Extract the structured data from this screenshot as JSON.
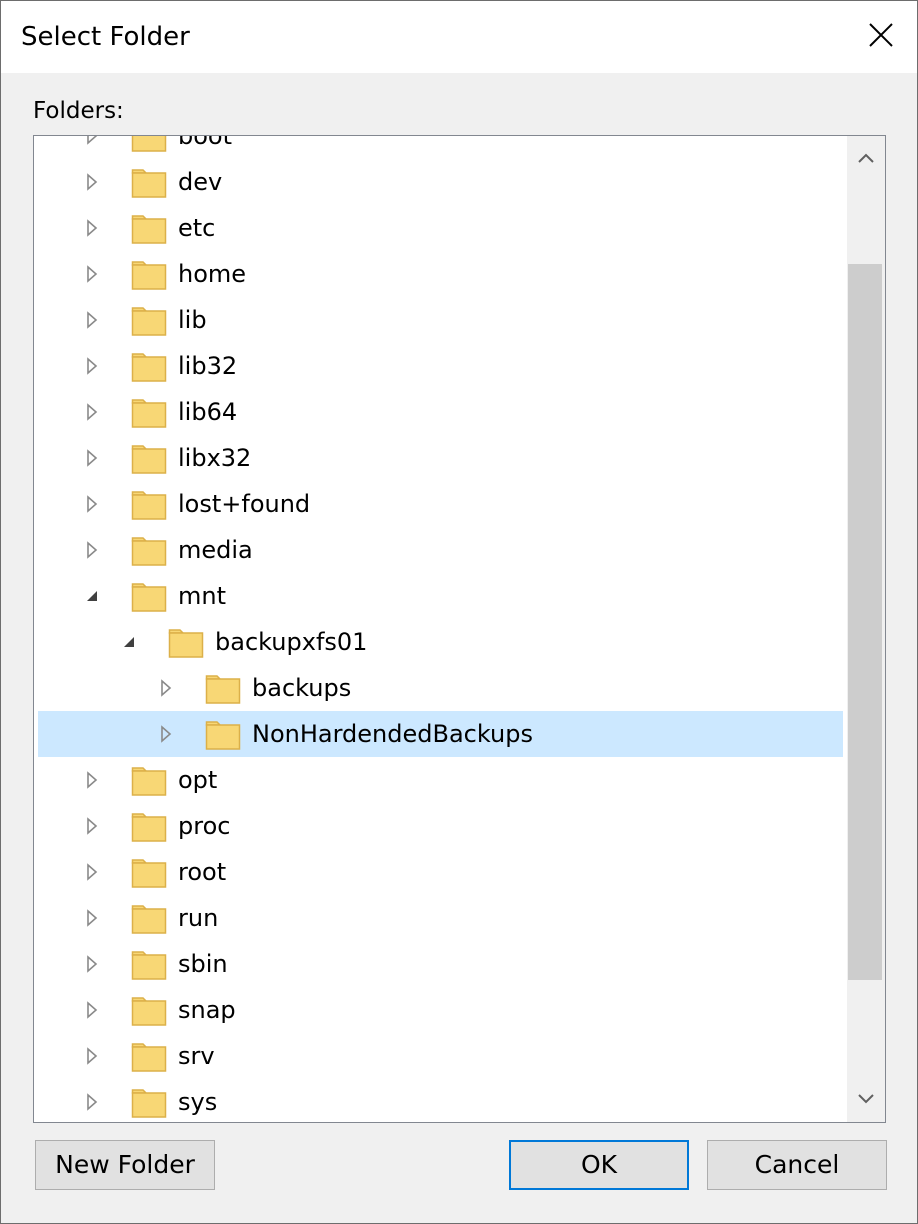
{
  "window": {
    "title": "Select Folder",
    "close_icon": "close-icon"
  },
  "folders_label": "Folders:",
  "tree": {
    "items": [
      {
        "label": "boot",
        "depth": 0,
        "expanded": false,
        "selected": false
      },
      {
        "label": "dev",
        "depth": 0,
        "expanded": false,
        "selected": false
      },
      {
        "label": "etc",
        "depth": 0,
        "expanded": false,
        "selected": false
      },
      {
        "label": "home",
        "depth": 0,
        "expanded": false,
        "selected": false
      },
      {
        "label": "lib",
        "depth": 0,
        "expanded": false,
        "selected": false
      },
      {
        "label": "lib32",
        "depth": 0,
        "expanded": false,
        "selected": false
      },
      {
        "label": "lib64",
        "depth": 0,
        "expanded": false,
        "selected": false
      },
      {
        "label": "libx32",
        "depth": 0,
        "expanded": false,
        "selected": false
      },
      {
        "label": "lost+found",
        "depth": 0,
        "expanded": false,
        "selected": false
      },
      {
        "label": "media",
        "depth": 0,
        "expanded": false,
        "selected": false
      },
      {
        "label": "mnt",
        "depth": 0,
        "expanded": true,
        "selected": false
      },
      {
        "label": "backupxfs01",
        "depth": 1,
        "expanded": true,
        "selected": false
      },
      {
        "label": "backups",
        "depth": 2,
        "expanded": false,
        "selected": false
      },
      {
        "label": "NonHardendedBackups",
        "depth": 2,
        "expanded": false,
        "selected": true
      },
      {
        "label": "opt",
        "depth": 0,
        "expanded": false,
        "selected": false
      },
      {
        "label": "proc",
        "depth": 0,
        "expanded": false,
        "selected": false
      },
      {
        "label": "root",
        "depth": 0,
        "expanded": false,
        "selected": false
      },
      {
        "label": "run",
        "depth": 0,
        "expanded": false,
        "selected": false
      },
      {
        "label": "sbin",
        "depth": 0,
        "expanded": false,
        "selected": false
      },
      {
        "label": "snap",
        "depth": 0,
        "expanded": false,
        "selected": false
      },
      {
        "label": "srv",
        "depth": 0,
        "expanded": false,
        "selected": false
      },
      {
        "label": "sys",
        "depth": 0,
        "expanded": false,
        "selected": false
      }
    ]
  },
  "buttons": {
    "new_folder": "New Folder",
    "ok": "OK",
    "cancel": "Cancel"
  },
  "colors": {
    "selection": "#cce8ff",
    "folder_fill": "#f8d775",
    "folder_stroke": "#dcb049",
    "default_button_border": "#0078d7"
  }
}
